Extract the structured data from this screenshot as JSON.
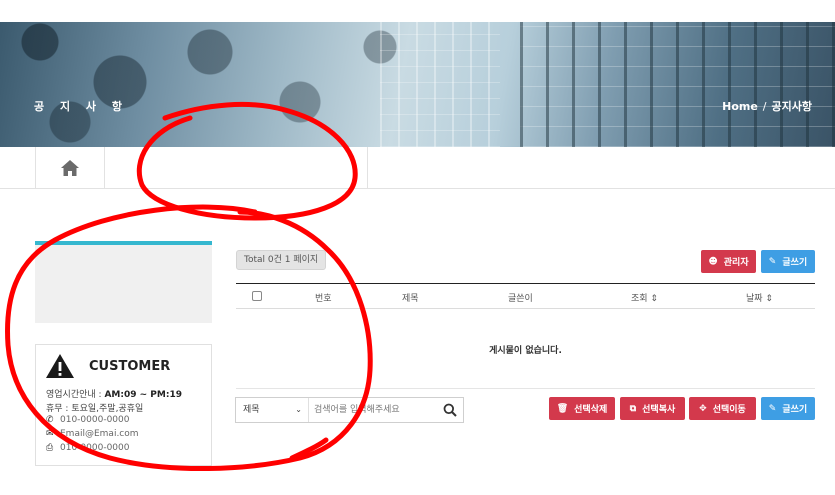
{
  "banner": {
    "title": "공 지 사 항",
    "breadcrumb": {
      "home": "Home",
      "separator": "/",
      "current": "공지사항"
    }
  },
  "subnav": {
    "home_icon": "home-icon"
  },
  "sidebar": {
    "customer": {
      "icon": "warning-triangle-icon",
      "title": "CUSTOMER",
      "hours_label": "영업시간안내 : ",
      "hours_value": "AM:09 ~ PM:19",
      "holiday": "휴무 : 토요일,주말,공휴일",
      "phone": "010-0000-0000",
      "email": "Email@Emai.com",
      "fax": "010-0000-0000"
    }
  },
  "board": {
    "total": "Total 0건 1 페이지",
    "admin_button": "관리자",
    "write_button": "글쓰기",
    "columns": [
      "번호",
      "제목",
      "글쓴이",
      "조회",
      "날짜"
    ],
    "empty_message": "게시물이 없습니다.",
    "search": {
      "field": "제목",
      "placeholder": "검색어를 입력해주세요"
    },
    "actions": {
      "delete": "선택삭제",
      "copy": "선택복사",
      "move": "선택이동",
      "write": "글쓰기"
    }
  },
  "colors": {
    "accent_cyan": "#35b7cf",
    "danger": "#d3394c",
    "primary": "#3e9ee4",
    "annotation": "#ff0000"
  }
}
